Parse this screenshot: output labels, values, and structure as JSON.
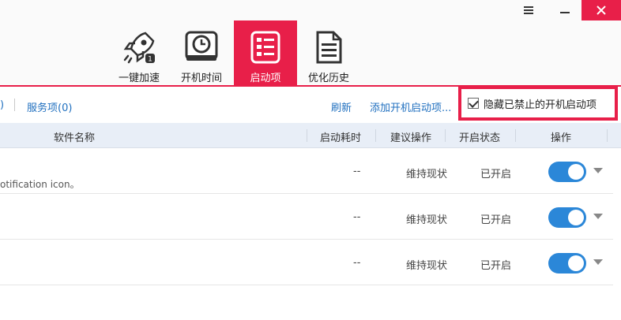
{
  "window": {
    "menu_icon": "menu-icon",
    "minimize_icon": "minimize-icon",
    "close_icon": "close-icon",
    "close_color": "#e81f49"
  },
  "nav": {
    "accent_color": "#e81f49",
    "tabs": [
      {
        "label": "一键加速",
        "icon": "rocket-icon",
        "active": false
      },
      {
        "label": "开机时间",
        "icon": "clock-icon",
        "active": false
      },
      {
        "label": "启动项",
        "icon": "startup-list-icon",
        "active": true
      },
      {
        "label": "优化历史",
        "icon": "document-icon",
        "active": false
      }
    ]
  },
  "toolbar": {
    "partial_count": ")",
    "services_tab": "服务项(0)",
    "refresh": "刷新",
    "add_startup": "添加开机启动项...",
    "hide_disabled": "隐藏已禁止的开机启动项",
    "hide_disabled_checked": true
  },
  "table": {
    "headers": {
      "name": "软件名称",
      "startup_time": "启动耗时",
      "suggestion": "建议操作",
      "status": "开启状态",
      "action": "操作"
    },
    "rows": [
      {
        "desc": "otification icon。",
        "startup_time": "--",
        "suggestion": "维持现状",
        "status": "已开启",
        "enabled": true
      },
      {
        "desc": "",
        "startup_time": "--",
        "suggestion": "维持现状",
        "status": "已开启",
        "enabled": true
      },
      {
        "desc": "",
        "startup_time": "--",
        "suggestion": "维持现状",
        "status": "已开启",
        "enabled": true
      }
    ]
  },
  "toggle_color": "#2b87d8"
}
